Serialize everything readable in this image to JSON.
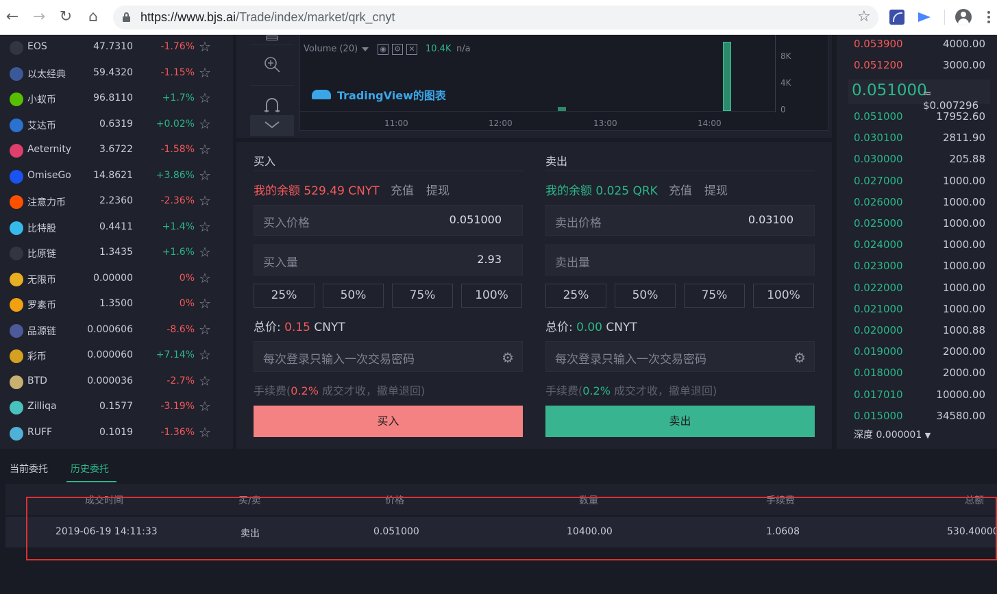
{
  "browser": {
    "url_host": "https://www.bjs.ai",
    "url_path": "/Trade/index/market/qrk_cnyt"
  },
  "market": [
    {
      "name": "EOS",
      "price": "47.7310",
      "change": "-1.76%",
      "dir": "down",
      "icon_color": "#333642",
      "icon": "eos-icon"
    },
    {
      "name": "以太经典",
      "price": "59.4320",
      "change": "-1.15%",
      "dir": "down",
      "icon_color": "#3b5998",
      "icon": "ethereum-classic-icon"
    },
    {
      "name": "小蚁币",
      "price": "96.8110",
      "change": "+1.7%",
      "dir": "up",
      "icon_color": "#58bf00",
      "icon": "neo-icon"
    },
    {
      "name": "艾达币",
      "price": "0.6319",
      "change": "+0.02%",
      "dir": "up",
      "icon_color": "#2a71d0",
      "icon": "cardano-icon"
    },
    {
      "name": "Aeternity",
      "price": "3.6722",
      "change": "-1.58%",
      "dir": "down",
      "icon_color": "#de3f6b",
      "icon": "aeternity-icon"
    },
    {
      "name": "OmiseGo",
      "price": "14.8621",
      "change": "+3.86%",
      "dir": "up",
      "icon_color": "#1a53f0",
      "icon": "omisego-icon"
    },
    {
      "name": "注意力币",
      "price": "2.2360",
      "change": "-2.36%",
      "dir": "down",
      "icon_color": "#ff5000",
      "icon": "bat-icon"
    },
    {
      "name": "比特股",
      "price": "0.4411",
      "change": "+1.4%",
      "dir": "up",
      "icon_color": "#35baeb",
      "icon": "bitshares-icon"
    },
    {
      "name": "比原链",
      "price": "1.3435",
      "change": "+1.6%",
      "dir": "up",
      "icon_color": "#333642",
      "icon": "bytom-icon"
    },
    {
      "name": "无限币",
      "price": "0.00000",
      "change": "0%",
      "dir": "down",
      "icon_color": "#e8b020",
      "icon": "infinitecoin-icon"
    },
    {
      "name": "罗素币",
      "price": "1.3500",
      "change": "0%",
      "dir": "down",
      "icon_color": "#f0a010",
      "icon": "luo-icon"
    },
    {
      "name": "品源链",
      "price": "0.000606",
      "change": "-8.6%",
      "dir": "down",
      "icon_color": "#4d5a9a",
      "icon": "pinyuan-icon"
    },
    {
      "name": "彩币",
      "price": "0.000060",
      "change": "+7.14%",
      "dir": "up",
      "icon_color": "#d4a020",
      "icon": "caibi-icon"
    },
    {
      "name": "BTD",
      "price": "0.000036",
      "change": "-2.7%",
      "dir": "down",
      "icon_color": "#c8b070",
      "icon": "btd-icon"
    },
    {
      "name": "Zilliqa",
      "price": "0.1577",
      "change": "-3.19%",
      "dir": "down",
      "icon_color": "#49c1bf",
      "icon": "zilliqa-icon"
    },
    {
      "name": "RUFF",
      "price": "0.1019",
      "change": "-1.36%",
      "dir": "down",
      "icon_color": "#4fb0d8",
      "icon": "ruff-icon"
    }
  ],
  "chart": {
    "volume_label": "Volume (20)",
    "volume_value": "10.4K",
    "volume_na": "n/a",
    "logo_text": "TradingView的图表",
    "time_labels": [
      "11:00",
      "12:00",
      "13:00",
      "14:00"
    ],
    "y_labels": [
      "8K",
      "4K",
      "0"
    ]
  },
  "buy": {
    "title": "买入",
    "balance": "我的余额 529.49 CNYT",
    "deposit": "充值",
    "withdraw": "提现",
    "price_label": "买入价格",
    "price_value": "0.051000",
    "amount_label": "买入量",
    "amount_value": "2.93",
    "pcts": [
      "25%",
      "50%",
      "75%",
      "100%"
    ],
    "total_label": "总价:",
    "total_value": "0.15",
    "total_unit": "CNYT",
    "password_placeholder": "每次登录只输入一次交易密码",
    "fee_prefix": "手续费(",
    "fee_rate": "0.2%",
    "fee_suffix": " 成交才收，撤单退回)",
    "button": "买入",
    "button_color": "#f58282"
  },
  "sell": {
    "title": "卖出",
    "balance": "我的余额 0.025 QRK",
    "deposit": "充值",
    "withdraw": "提现",
    "price_label": "卖出价格",
    "price_value": "0.03100",
    "amount_label": "卖出量",
    "amount_value": "",
    "pcts": [
      "25%",
      "50%",
      "75%",
      "100%"
    ],
    "total_label": "总价:",
    "total_value": "0.00",
    "total_unit": "CNYT",
    "password_placeholder": "每次登录只输入一次交易密码",
    "fee_prefix": "手续费(",
    "fee_rate": "0.2%",
    "fee_suffix": " 成交才收，撤单退回)",
    "button": "卖出",
    "button_color": "#38b490"
  },
  "orderbook": {
    "asks": [
      {
        "price": "0.053900",
        "qty": "4000.00"
      },
      {
        "price": "0.051200",
        "qty": "3000.00"
      }
    ],
    "last_price": "0.051000",
    "last_usd": "≈ $0.007296",
    "bids": [
      {
        "price": "0.051000",
        "qty": "17952.60"
      },
      {
        "price": "0.030100",
        "qty": "2811.90"
      },
      {
        "price": "0.030000",
        "qty": "205.88"
      },
      {
        "price": "0.027000",
        "qty": "1000.00"
      },
      {
        "price": "0.026000",
        "qty": "1000.00"
      },
      {
        "price": "0.025000",
        "qty": "1000.00"
      },
      {
        "price": "0.024000",
        "qty": "1000.00"
      },
      {
        "price": "0.023000",
        "qty": "1000.00"
      },
      {
        "price": "0.022000",
        "qty": "1000.00"
      },
      {
        "price": "0.021000",
        "qty": "1000.00"
      },
      {
        "price": "0.020000",
        "qty": "1000.88"
      },
      {
        "price": "0.019000",
        "qty": "2000.00"
      },
      {
        "price": "0.018000",
        "qty": "2000.00"
      },
      {
        "price": "0.017010",
        "qty": "10000.00"
      },
      {
        "price": "0.015000",
        "qty": "34580.00"
      }
    ],
    "depth_label": "深度 0.000001"
  },
  "orders": {
    "tabs": [
      "当前委托",
      "历史委托"
    ],
    "active_tab": 1,
    "headers": [
      "成交时间",
      "买/卖",
      "价格",
      "数量",
      "手续费",
      "总额"
    ],
    "rows": [
      {
        "time": "2019-06-19 14:11:33",
        "side": "卖出",
        "price": "0.051000",
        "amount": "10400.00",
        "fee": "1.0608",
        "total": "530.40000"
      }
    ]
  },
  "colors": {
    "up": "#2ab889",
    "down": "#f55a5a",
    "bg": "#181a24",
    "panel": "#1f212c"
  }
}
